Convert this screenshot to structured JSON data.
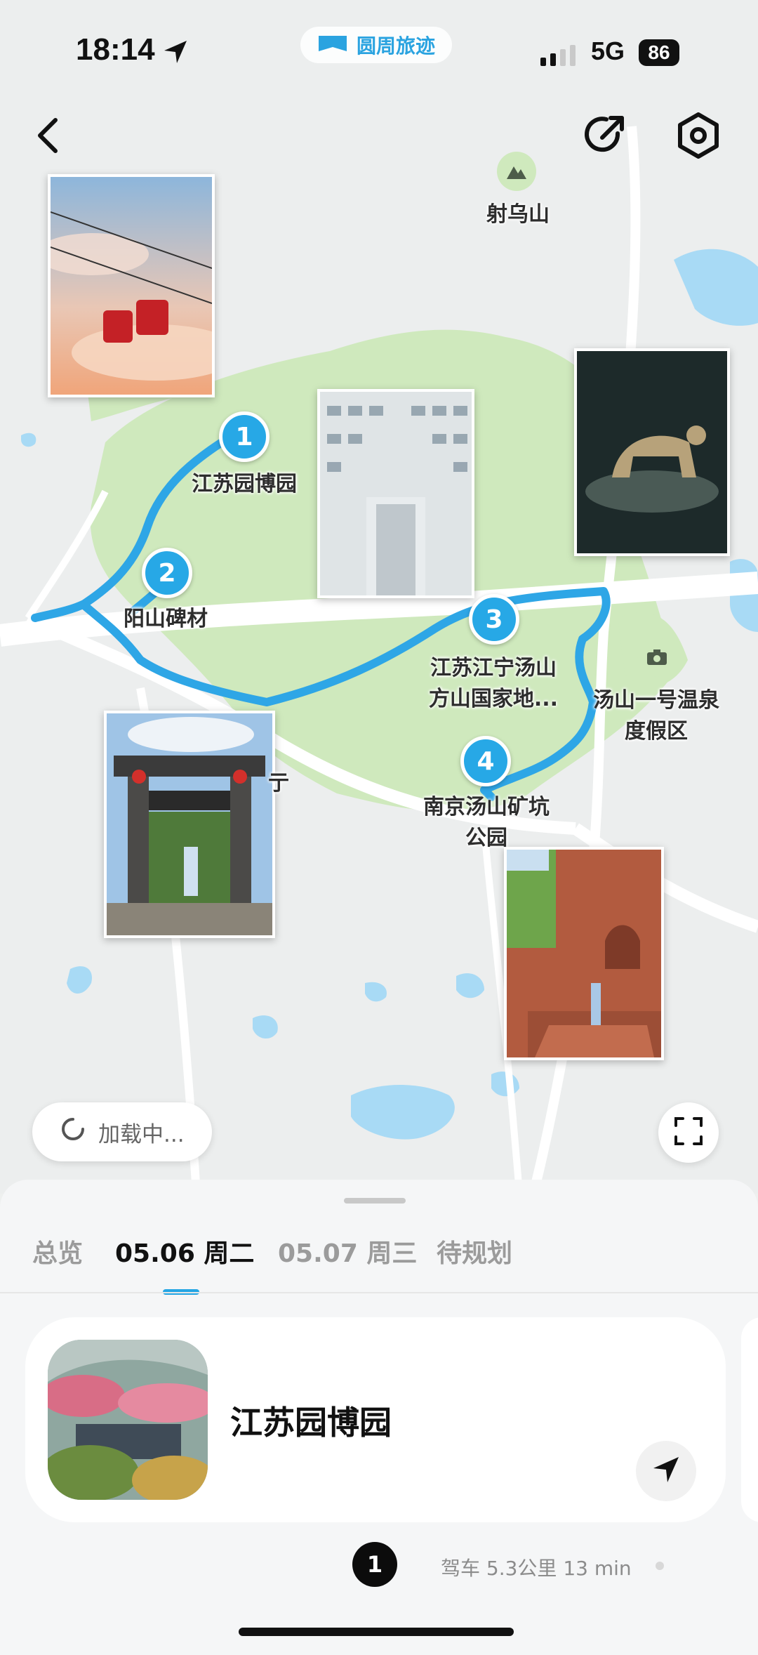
{
  "status_bar": {
    "time": "18:14",
    "network": "5G",
    "battery": "86"
  },
  "app_pill": {
    "name": "圆周旅迹"
  },
  "map": {
    "pois": [
      {
        "label": "射乌山"
      },
      {
        "label": "汤山一号温泉\n度假区"
      }
    ],
    "stops": [
      {
        "number": "1",
        "label": "江苏园博园"
      },
      {
        "number": "2",
        "label": "阳山碑材"
      },
      {
        "number": "3",
        "label": "江苏江宁汤山\n方山国家地..."
      },
      {
        "number": "4",
        "label": "南京汤山矿坑\n公园"
      }
    ],
    "partial_label": "亍",
    "loading_text": "加载中..."
  },
  "sheet": {
    "tabs": [
      {
        "label": "总览",
        "active": false
      },
      {
        "label": "05.06 周二",
        "active": true
      },
      {
        "label": "05.07 周三",
        "active": false
      },
      {
        "label": "待规划",
        "active": false
      }
    ],
    "card": {
      "name": "江苏园博园"
    },
    "route": {
      "step": "1",
      "info": "驾车 5.3公里 13 min"
    }
  },
  "colors": {
    "route": "#2ea6e6",
    "accent": "#25a6e4",
    "park": "#cfe9bd",
    "water": "#a8daf5"
  },
  "icons": [
    "location-arrow-icon",
    "app-flag-icon",
    "signal-icon",
    "back-icon",
    "share-icon",
    "settings-icon",
    "mountain-icon",
    "camera-icon",
    "spinner-icon",
    "fullscreen-icon",
    "navigate-icon"
  ]
}
